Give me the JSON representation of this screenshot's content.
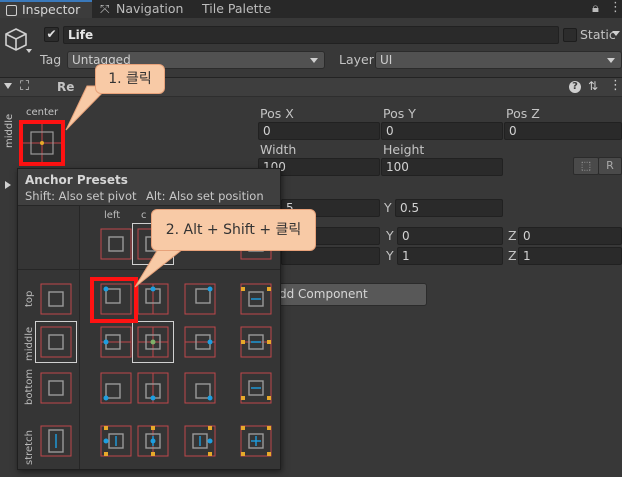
{
  "tabs": {
    "inspector": "Inspector",
    "navigation": "Navigation",
    "tile_palette": "Tile Palette"
  },
  "object": {
    "name": "Life",
    "static_label": "Static",
    "tag_label": "Tag",
    "tag_value": "Untagged",
    "layer_label": "Layer",
    "layer_value": "UI"
  },
  "component": {
    "title_partial": "Re"
  },
  "anchor_widget": {
    "h_label": "center",
    "v_label": "middle"
  },
  "fields": {
    "pos_x_label": "Pos X",
    "pos_x": "0",
    "pos_y_label": "Pos Y",
    "pos_y": "0",
    "pos_z_label": "Pos Z",
    "pos_z": "0",
    "width_label": "Width",
    "width": "100",
    "height_label": "Height",
    "height": "100",
    "r_button": "R",
    "pivot_y_label": "Y",
    "pivot_y": "0.5",
    "pivot_x_partial": "5",
    "rot_y_label": "Y",
    "rot_y": "0",
    "rot_z_label": "Z",
    "rot_z": "0",
    "scale_y_label": "Y",
    "scale_y": "1",
    "scale_z_label": "Z",
    "scale_z": "1",
    "add_component_partial": "dd Component"
  },
  "popup": {
    "title": "Anchor Presets",
    "hint_left": "Shift: Also set pivot",
    "hint_right": "Alt: Also set position",
    "col_left": "left",
    "col_center_partial": "c",
    "row_top": "top",
    "row_middle": "middle",
    "row_bottom": "bottom",
    "row_stretch": "stretch"
  },
  "callouts": {
    "step1": "1. 클릭",
    "step2": "2. Alt + Shift + 클릭"
  },
  "colors": {
    "accent": "#3a79bb",
    "highlight": "#ff1212",
    "callout": "#f8caa6",
    "anchor_dot": "#1e9ee0",
    "anchor_line": "#c0464a",
    "stretch_arrow": "#e7a92a"
  }
}
